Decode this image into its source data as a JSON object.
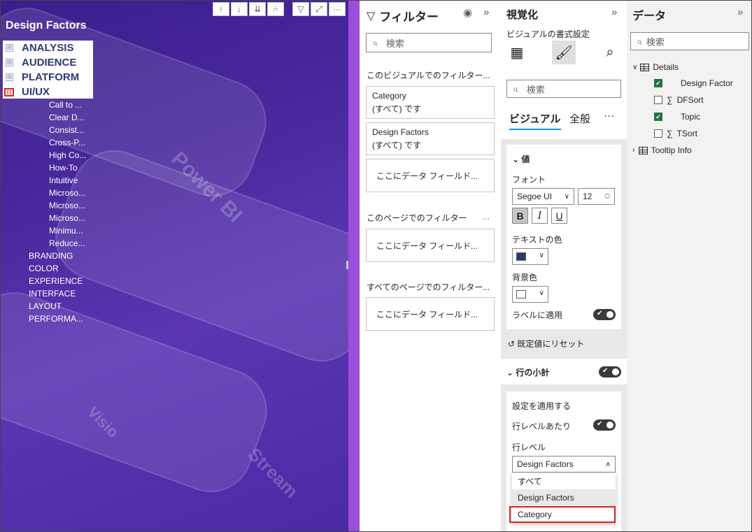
{
  "visual": {
    "title": "Design Factors",
    "toolbar_icons": [
      "arrow-up-icon",
      "arrow-down-icon",
      "double-arrow-down-icon",
      "expand-hierarchy-icon",
      "filter-icon",
      "focus-mode-icon",
      "more-options-icon"
    ],
    "top_nodes": [
      {
        "label": "ANALYSIS",
        "symbol": "⊞"
      },
      {
        "label": "AUDIENCE",
        "symbol": "⊞"
      },
      {
        "label": "PLATFORM",
        "symbol": "⊞"
      },
      {
        "label": "UI/UX",
        "symbol": "⊟"
      }
    ],
    "uiux_children": [
      "Call to ...",
      "Clear D...",
      "Consist...",
      "Cross-P...",
      "High Co...",
      "How-To",
      "Intuitive",
      "Microso...",
      "Microso...",
      "Microso...",
      "Minimu...",
      "Reduce..."
    ],
    "categories": [
      "BRANDING",
      "COLOR",
      "EXPERIENCE",
      "INTERFACE",
      "LAYOUT",
      "PERFORMA..."
    ],
    "watermarks": [
      "Power BI",
      "Visio",
      "Stream"
    ]
  },
  "filters": {
    "title": "フィルター",
    "search_placeholder": "検索",
    "visual_section": "このビジュアルでのフィルター...",
    "cards": [
      {
        "field": "Category",
        "value": "(すべて) です"
      },
      {
        "field": "Design Factors",
        "value": "(すべて) です"
      }
    ],
    "drop_here": "ここにデータ フィールド...",
    "page_section": "このページでのフィルター",
    "page_more": "...",
    "all_pages_section": "すべてのページでのフィルター..."
  },
  "visualizations": {
    "title": "視覚化",
    "format_subtitle": "ビジュアルの書式設定",
    "search_placeholder": "検索",
    "tabs": [
      "ビジュアル",
      "全般"
    ],
    "more": "···",
    "values_card": {
      "header": "値",
      "font_label": "フォント",
      "font_family": "Segoe UI",
      "font_size": "12",
      "bold": "B",
      "italic": "I",
      "underline": "U",
      "text_color_label": "テキストの色",
      "text_color": "#2b3a6b",
      "bg_color_label": "背景色",
      "bg_color": "#ffffff",
      "apply_to_labels": "ラベルに適用"
    },
    "reset_label": "既定値にリセット",
    "row_subtotals": "行の小計",
    "apply_settings": {
      "header": "設定を適用する",
      "per_row_level": "行レベルあたり",
      "row_level_label": "行レベル",
      "row_level_value": "Design Factors",
      "options": [
        "すべて",
        "Design Factors",
        "Category"
      ]
    }
  },
  "data": {
    "title": "データ",
    "search_placeholder": "検索",
    "tables": [
      {
        "name": "Details",
        "fields": [
          {
            "name": "Design Factor",
            "checked": true,
            "sigma": false
          },
          {
            "name": "DFSort",
            "checked": false,
            "sigma": true
          },
          {
            "name": "Topic",
            "checked": true,
            "sigma": false
          },
          {
            "name": "TSort",
            "checked": false,
            "sigma": true
          }
        ]
      },
      {
        "name": "Tooltip Info"
      }
    ]
  },
  "colors": {
    "canvas_purple": "#4a2a9f",
    "accent_bar": "#9c4ddc",
    "highlight_red": "#e02020",
    "check_green": "#217346",
    "tab_underline": "#118dff"
  }
}
